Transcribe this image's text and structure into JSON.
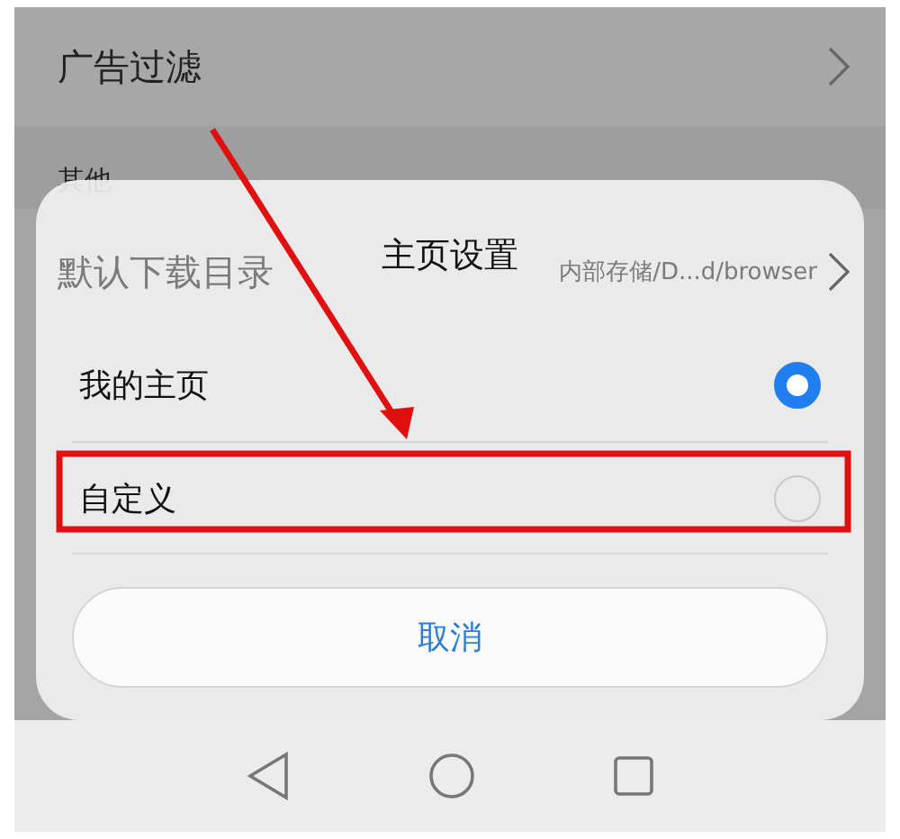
{
  "settings": [
    {
      "label": "广告过滤",
      "kind": "link"
    }
  ],
  "section": "其他",
  "background_row": {
    "label": "默认下载目录",
    "value": "内部存储/D...d/browser"
  },
  "dialog": {
    "title": "主页设置",
    "options": [
      {
        "label": "我的主页",
        "selected": true
      },
      {
        "label": "自定义",
        "selected": false
      }
    ],
    "cancel": "取消"
  }
}
